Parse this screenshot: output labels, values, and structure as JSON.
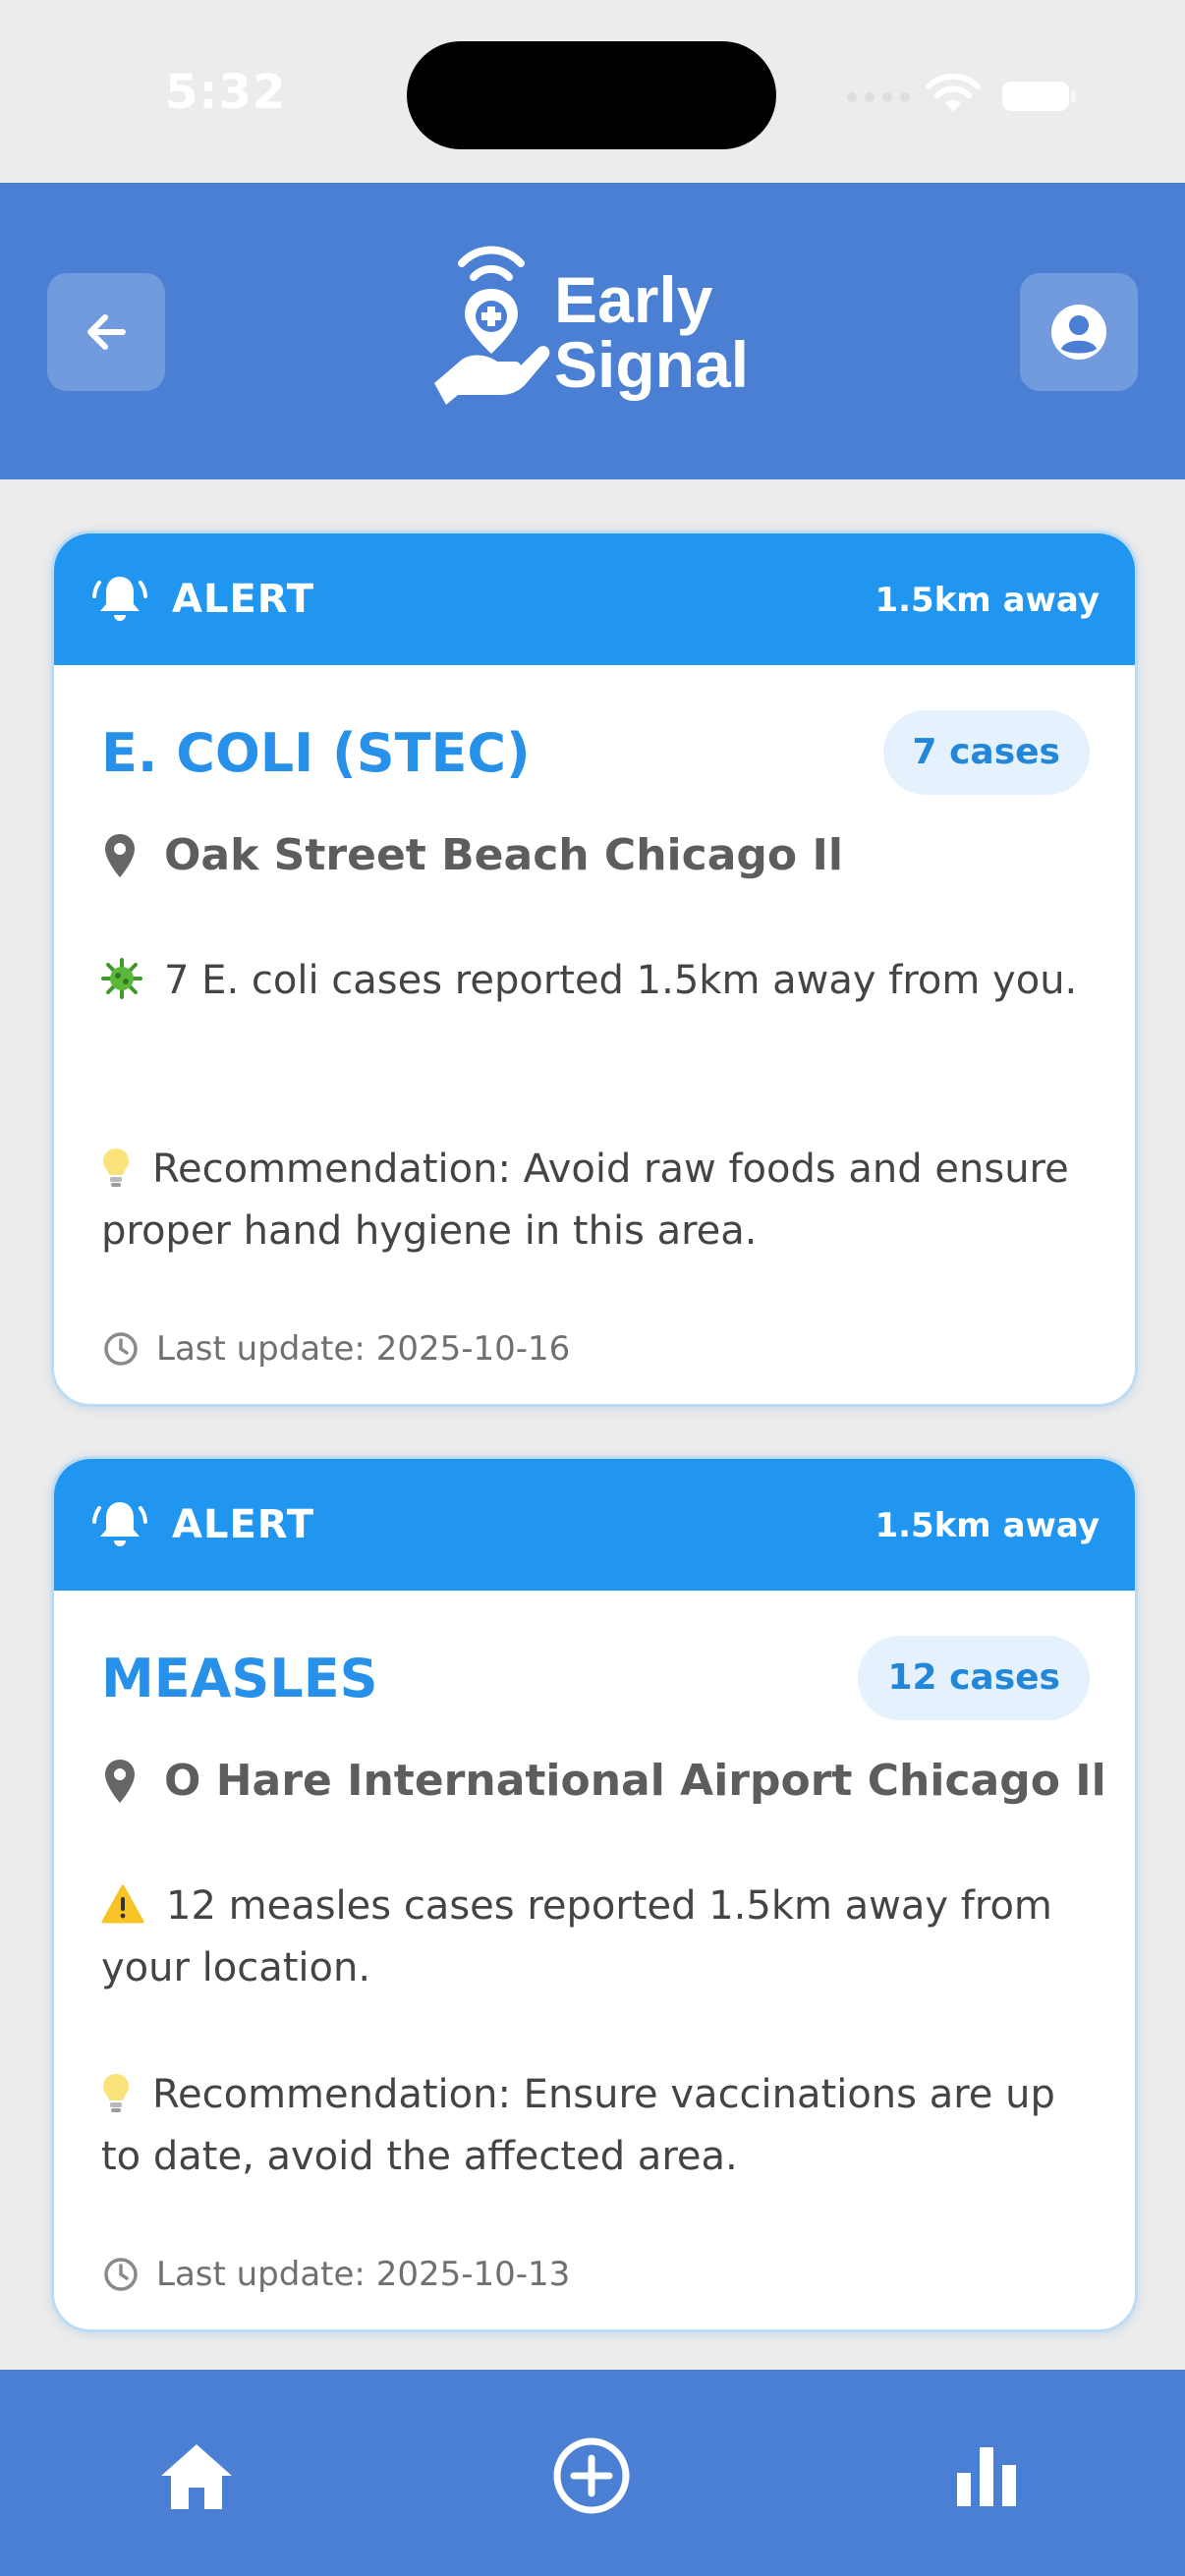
{
  "status_bar": {
    "time": "5:32"
  },
  "header": {
    "brand_line1": "Early",
    "brand_line2": "Signal"
  },
  "alerts": [
    {
      "label": "ALERT",
      "distance": "1.5km away",
      "disease": "E. COLI (STEC)",
      "cases": "7 cases",
      "location": "Oak Street Beach Chicago Il",
      "description": "7 E. coli cases reported 1.5km away from you.",
      "description_icon": "microbe-icon",
      "recommendation": "Recommendation: Avoid raw foods and ensure proper hand hygiene in this area.",
      "last_update": "Last update: 2025-10-16"
    },
    {
      "label": "ALERT",
      "distance": "1.5km away",
      "disease": "MEASLES",
      "cases": "12 cases",
      "location": "O Hare International Airport Chicago Il",
      "description": "12 measles cases reported 1.5km away from your location.",
      "description_icon": "warning-icon",
      "recommendation": "Recommendation: Ensure vaccinations are up to date, avoid the affected area.",
      "last_update": "Last update: 2025-10-13"
    }
  ],
  "colors": {
    "header": "#4a7fd4",
    "card_header": "#2196f0",
    "title": "#2790e8",
    "badge_bg": "#e5f2fd"
  },
  "nav": {
    "items": [
      {
        "icon": "home-icon"
      },
      {
        "icon": "plus-circle-icon"
      },
      {
        "icon": "bar-chart-icon"
      }
    ]
  }
}
